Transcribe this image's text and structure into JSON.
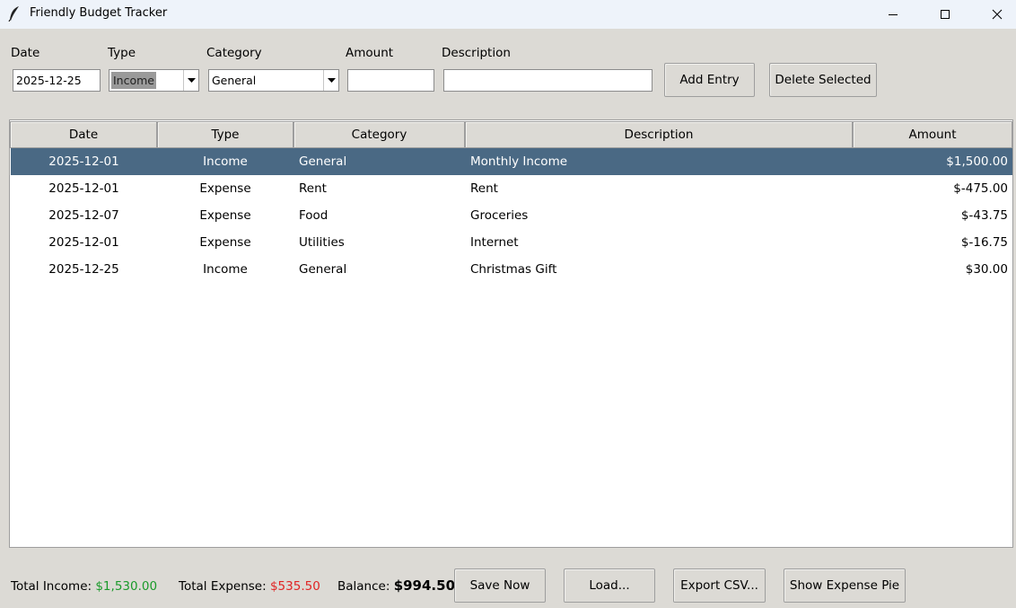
{
  "window": {
    "title": "Friendly Budget Tracker"
  },
  "form": {
    "date_label": "Date",
    "type_label": "Type",
    "category_label": "Category",
    "amount_label": "Amount",
    "description_label": "Description",
    "date_value": "2025-12-25",
    "type_value": "Income",
    "category_value": "General",
    "amount_value": "",
    "description_value": "",
    "add_button": "Add Entry",
    "delete_button": "Delete Selected"
  },
  "table": {
    "columns": [
      "Date",
      "Type",
      "Category",
      "Description",
      "Amount"
    ],
    "rows": [
      {
        "date": "2025-12-01",
        "type": "Income",
        "category": "General",
        "description": "Monthly Income",
        "amount": "$1,500.00",
        "selected": true
      },
      {
        "date": "2025-12-01",
        "type": "Expense",
        "category": "Rent",
        "description": "Rent",
        "amount": "$-475.00",
        "selected": false
      },
      {
        "date": "2025-12-07",
        "type": "Expense",
        "category": "Food",
        "description": "Groceries",
        "amount": "$-43.75",
        "selected": false
      },
      {
        "date": "2025-12-01",
        "type": "Expense",
        "category": "Utilities",
        "description": "Internet",
        "amount": "$-16.75",
        "selected": false
      },
      {
        "date": "2025-12-25",
        "type": "Income",
        "category": "General",
        "description": "Christmas Gift",
        "amount": "$30.00",
        "selected": false
      }
    ]
  },
  "summary": {
    "income_label": "Total Income:",
    "income_value": "$1,530.00",
    "expense_label": "Total Expense:",
    "expense_value": "$535.50",
    "balance_label": "Balance:",
    "balance_value": "$994.50"
  },
  "actions": {
    "save": "Save Now",
    "load": "Load...",
    "export": "Export CSV...",
    "pie": "Show Expense Pie"
  },
  "colors": {
    "selected_row": "#4a6984",
    "income_value": "#1a9a2a",
    "expense_value": "#e02424",
    "window_bg": "#dcdad5"
  }
}
